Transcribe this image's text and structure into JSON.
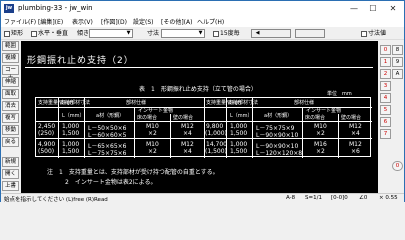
{
  "titlebar": {
    "app_icon": "jw",
    "title": "plumbing-33 - jw_win",
    "min": "—",
    "max": "☐",
    "close": "✕"
  },
  "menubar": {
    "items": [
      "ファイル(F)",
      "[編集](E)",
      "表示(V)",
      "[作図](D)",
      "設定(S)",
      "[その他](A)",
      "ヘルプ(H)"
    ]
  },
  "toolbar": {
    "rect": "矩形",
    "hv": "水平・垂直",
    "tilt_label": "傾き",
    "tilt_value": "",
    "size_label": "寸法",
    "size_value": "",
    "deg15": "15度毎",
    "dim_lock": "寸法値"
  },
  "left_tools": [
    "範囲",
    "複線",
    "コーナ",
    "伸縮",
    "面取",
    "消去",
    "複写",
    "移動",
    "戻る",
    "新規",
    "開く",
    "上書"
  ],
  "right_tools": [
    "0",
    "1",
    "2",
    "3",
    "4",
    "5",
    "6",
    "7",
    "8",
    "9",
    "A",
    "0"
  ],
  "canvas": {
    "heading": "形鋼振れ止め支持（2）",
    "table_title": "表　1　形鋼振れ止め支持（立て管の場合）",
    "unit": "単位　mm",
    "headers": {
      "col1": "支持重量N(kgf)",
      "col2": "支持部材寸法",
      "col3": "部材仕様",
      "col4": "インサート金物",
      "a_label": "a材（形鋼）",
      "floor": "床の場合",
      "wall": "壁の場合",
      "L": "L（mm）"
    },
    "rows_left": [
      [
        "2,450",
        "1,000",
        "L－50×50×6",
        "M10",
        "M12"
      ],
      [
        "(250)",
        "1,500",
        "L－60×60×5",
        "×2",
        "×4"
      ],
      [
        "4,900",
        "1,000",
        "L－65×65×6",
        "M10",
        "M12"
      ],
      [
        "(500)",
        "1,500",
        "L－75×75×6",
        "×2",
        "×4"
      ]
    ],
    "rows_right": [
      [
        "9,800",
        "1,000",
        "L－75×75×9",
        "M10",
        "M12"
      ],
      [
        "(1,000)",
        "1,500",
        "L－90×90×10",
        "×2",
        "×4"
      ],
      [
        "14,700",
        "1,000",
        "L－90×90×10",
        "M16",
        "M12"
      ],
      [
        "(1,500)",
        "1,500",
        "L－120×120×8",
        "×2",
        "×6"
      ]
    ],
    "note1": "注　1　支持重量とは、支持部材が受け持つ配管の自重とする。",
    "note2": "2　インサート金物は表2による。"
  },
  "statusbar": {
    "hint": "始点を指示してください (L)free (R)Read",
    "layer": "A-8",
    "scale": "S=1/1",
    "group": "[0-0]0",
    "angle": "∠0",
    "zoom": "× 0.55"
  }
}
